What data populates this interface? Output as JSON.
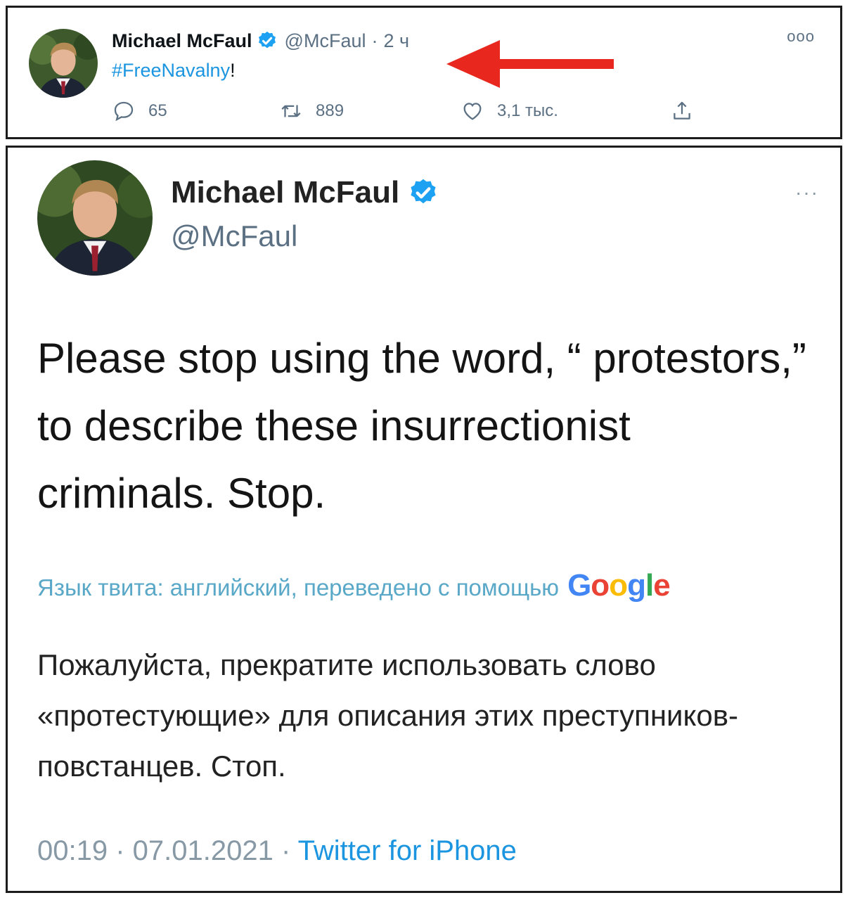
{
  "top_tweet": {
    "author_name": "Michael McFaul",
    "handle": "@McFaul",
    "separator": "·",
    "time": "2 ч",
    "hashtag": "#FreeNavalny",
    "text_suffix": "!",
    "more_label": "ooo",
    "actions": {
      "replies": "65",
      "retweets": "889",
      "likes": "3,1 тыс."
    }
  },
  "bottom_tweet": {
    "author_name": "Michael McFaul",
    "handle": "@McFaul",
    "more_label": "···",
    "text": "Please stop using the word, “ protestors,” to describe these insurrectionist criminals. Stop.",
    "translation_notice": "Язык твита: английский, переведено с помощью",
    "translation_provider": "Google",
    "translation": "Пожалуйста, прекратите использовать слово «протестующие» для описания этих преступников-повстанцев. Стоп.",
    "timestamp": "00:19 · 07.01.2021 ·",
    "source": "Twitter for iPhone"
  },
  "colors": {
    "link_blue": "#1b95e0",
    "muted_gray": "#5b7083",
    "arrow_red": "#e8281e",
    "frame_border": "#1c1c1c"
  }
}
